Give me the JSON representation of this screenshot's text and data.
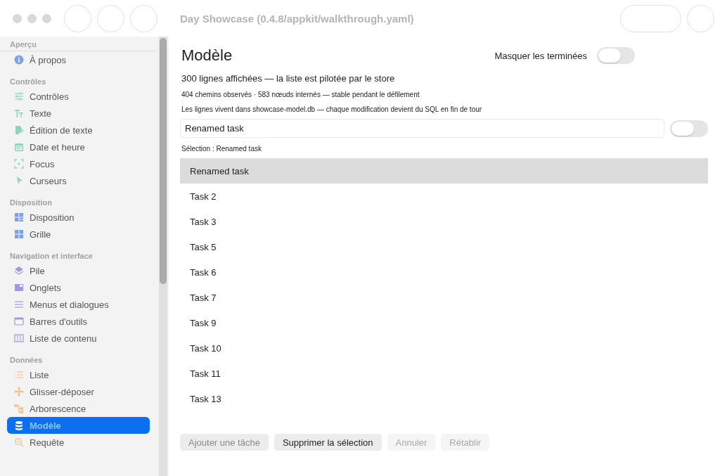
{
  "window": {
    "title": "Day Showcase (0.4.8/appkit/walkthrough.yaml)",
    "focused": false
  },
  "sidebar": {
    "sections": [
      {
        "title": "Aperçu",
        "items": [
          {
            "label": "À propos",
            "selected": false
          }
        ]
      },
      {
        "title": "Contrôles",
        "items": [
          {
            "label": "Contrôles",
            "selected": false
          },
          {
            "label": "Texte",
            "selected": false
          },
          {
            "label": "Édition de texte",
            "selected": false
          },
          {
            "label": "Date et heure",
            "selected": false
          },
          {
            "label": "Focus",
            "selected": false
          },
          {
            "label": "Curseurs",
            "selected": false
          }
        ]
      },
      {
        "title": "Disposition",
        "items": [
          {
            "label": "Disposition",
            "selected": false
          },
          {
            "label": "Grille",
            "selected": false
          }
        ]
      },
      {
        "title": "Navigation et interface",
        "items": [
          {
            "label": "Pile",
            "selected": false
          },
          {
            "label": "Onglets",
            "selected": false
          },
          {
            "label": "Menus et dialogues",
            "selected": false
          },
          {
            "label": "Barres d'outils",
            "selected": false
          },
          {
            "label": "Liste de contenu",
            "selected": false
          }
        ]
      },
      {
        "title": "Données",
        "items": [
          {
            "label": "Liste",
            "selected": false
          },
          {
            "label": "Glisser-déposer",
            "selected": false
          },
          {
            "label": "Arborescence",
            "selected": false
          },
          {
            "label": "Modèle",
            "selected": true
          },
          {
            "label": "Requête",
            "selected": false
          }
        ]
      }
    ]
  },
  "content": {
    "title": "Modèle",
    "hide_done": {
      "label": "Masquer les terminées",
      "on": false
    },
    "summary": "300 lignes affichées — la liste est pilotée par le store",
    "stats": "404 chemins observés · 583 nœuds internés — stable pendant le défilement",
    "note": "Les lignes vivent dans showcase-model.db — chaque modification devient du SQL en fin de tour",
    "editor": {
      "value": "Renamed task",
      "done": false
    },
    "selection": "Sélection : Renamed task",
    "rows": [
      {
        "label": "Renamed task",
        "selected": true
      },
      {
        "label": "Task 2",
        "selected": false
      },
      {
        "label": "Task 3",
        "selected": false
      },
      {
        "label": "Task 5",
        "selected": false
      },
      {
        "label": "Task 6",
        "selected": false
      },
      {
        "label": "Task 7",
        "selected": false
      },
      {
        "label": "Task 9",
        "selected": false
      },
      {
        "label": "Task 10",
        "selected": false
      },
      {
        "label": "Task 11",
        "selected": false
      },
      {
        "label": "Task 13",
        "selected": false
      }
    ],
    "buttons": [
      {
        "label": "Ajouter une tâche",
        "kind": "primary",
        "disabled": true
      },
      {
        "label": "Supprimer la sélection",
        "kind": "plain",
        "disabled": false
      },
      {
        "label": "Annuler",
        "kind": "plain",
        "disabled": true
      },
      {
        "label": "Rétablir",
        "kind": "plain",
        "disabled": true
      }
    ]
  }
}
